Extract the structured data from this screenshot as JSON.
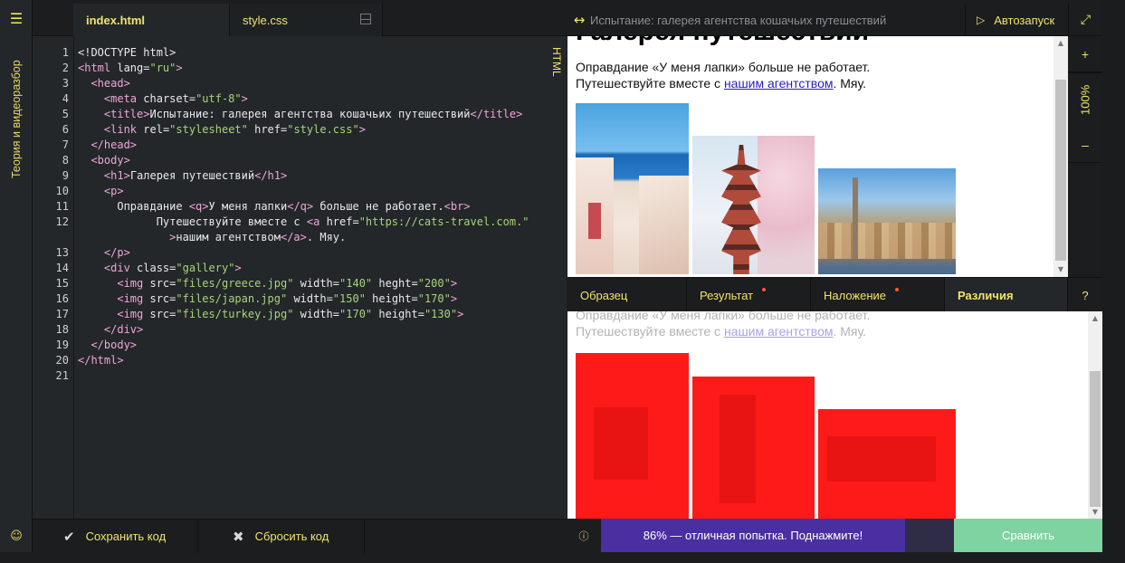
{
  "sidebar": {
    "menu_icon": "hamburger-icon",
    "vertical_label": "Теория и видеоразбор",
    "feedback_icon": "feedback-icon"
  },
  "editor": {
    "tabs": [
      {
        "label": "index.html",
        "active": true
      },
      {
        "label": "style.css",
        "active": false
      }
    ],
    "mode_label": "HTML",
    "line_numbers": [
      "1",
      "2",
      "3",
      "4",
      "5",
      "6",
      "7",
      "8",
      "9",
      "10",
      "11",
      "12",
      "",
      "13",
      "14",
      "15",
      "16",
      "17",
      "18",
      "19",
      "20",
      "21"
    ],
    "footer": {
      "save_label": "Сохранить код",
      "reset_label": "Сбросить код"
    }
  },
  "preview": {
    "title": "Испытание: галерея агентства кошачьих путешествий",
    "autorun_label": "Автозапуск",
    "zoom_plus": "+",
    "zoom_value": "100%",
    "zoom_minus": "–",
    "heading": "Галерея путешествий",
    "para_line1": "Оправдание «У меня лапки» больше не работает.",
    "para_line2_prefix": "Путешествуйте вместе с ",
    "para_link": "нашим агентством",
    "para_line2_suffix": ". Мяу."
  },
  "compare_tabs": [
    {
      "label": "Образец",
      "dot": false
    },
    {
      "label": "Результат",
      "dot": true
    },
    {
      "label": "Наложение",
      "dot": true
    },
    {
      "label": "Различия",
      "dot": false,
      "active": true
    },
    {
      "label": "?",
      "dot": false
    }
  ],
  "footer": {
    "result_text": "86% — отличная попытка. Поднажмите!",
    "compare_label": "Сравнить"
  },
  "colors": {
    "accent": "#f0e36b",
    "result_bg": "#4a2fa0",
    "compare_bg": "#7ed3a1",
    "diff_red": "#ff1a1a",
    "tag": "#f0a4d8",
    "string": "#a8d37a"
  }
}
